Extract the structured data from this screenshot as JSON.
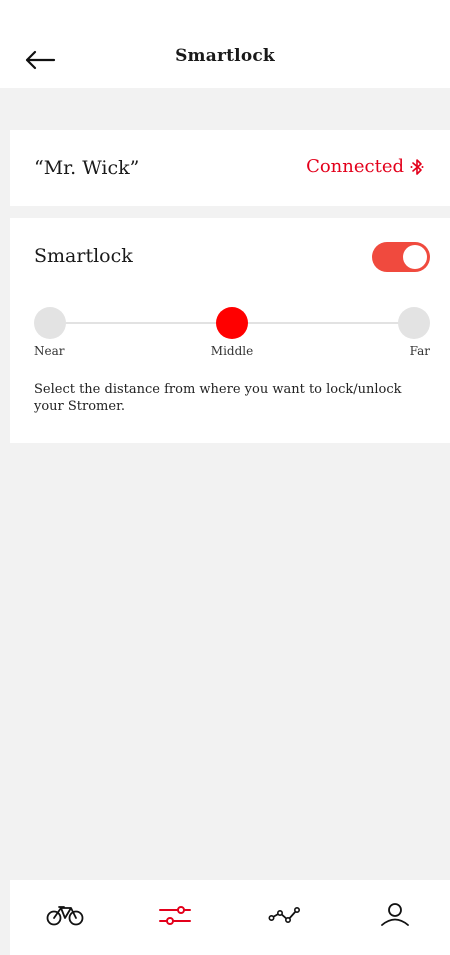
{
  "header": {
    "title": "Smartlock",
    "back_icon": "arrow-left-icon"
  },
  "bike": {
    "name": "“Mr. Wick”",
    "status": "Connected",
    "status_icon": "bluetooth-icon",
    "status_color": "#e3001b"
  },
  "smartlock": {
    "label": "Smartlock",
    "enabled": true,
    "toggle_color": "#f04a3e",
    "distance_options": [
      "Near",
      "Middle",
      "Far"
    ],
    "selected_distance": "Middle",
    "active_color": "#ff0000",
    "help_text": "Select the distance from where you want to lock/unlock your Stromer."
  },
  "bottom_nav": {
    "items": [
      {
        "icon": "bike-icon",
        "active": false
      },
      {
        "icon": "sliders-icon",
        "active": true
      },
      {
        "icon": "route-icon",
        "active": false
      },
      {
        "icon": "profile-icon",
        "active": false
      }
    ],
    "active_color": "#e3001b"
  }
}
